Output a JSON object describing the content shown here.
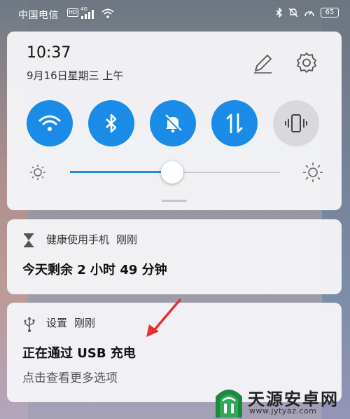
{
  "status_bar": {
    "carrier": "中国电信",
    "hd_badge": "HD",
    "network": "4G",
    "battery": "65"
  },
  "quick_settings": {
    "time": "10:37",
    "date": "9月16日星期三 上午",
    "tiles": [
      {
        "name": "wifi",
        "icon": "wifi-icon",
        "state": "on"
      },
      {
        "name": "bluetooth",
        "icon": "bluetooth-icon",
        "state": "on"
      },
      {
        "name": "mute",
        "icon": "bell-off-icon",
        "state": "on"
      },
      {
        "name": "mobile-data",
        "icon": "data-arrows-icon",
        "state": "on"
      },
      {
        "name": "vibrate",
        "icon": "vibrate-icon",
        "state": "off"
      }
    ],
    "brightness": 0.5
  },
  "notifications": [
    {
      "app": "健康使用手机",
      "time": "刚刚",
      "title": "今天剩余 2 小时 49 分钟",
      "icon": "hourglass-icon"
    },
    {
      "app": "设置",
      "time": "刚刚",
      "title": "正在通过 USB 充电",
      "subtitle": "点击查看更多选项",
      "icon": "usb-icon"
    }
  ],
  "watermark": {
    "title": "天源安卓网",
    "url": "www.jytyaz.com"
  },
  "colors": {
    "accent": "#1a8be6",
    "arrow": "#e5312f"
  }
}
